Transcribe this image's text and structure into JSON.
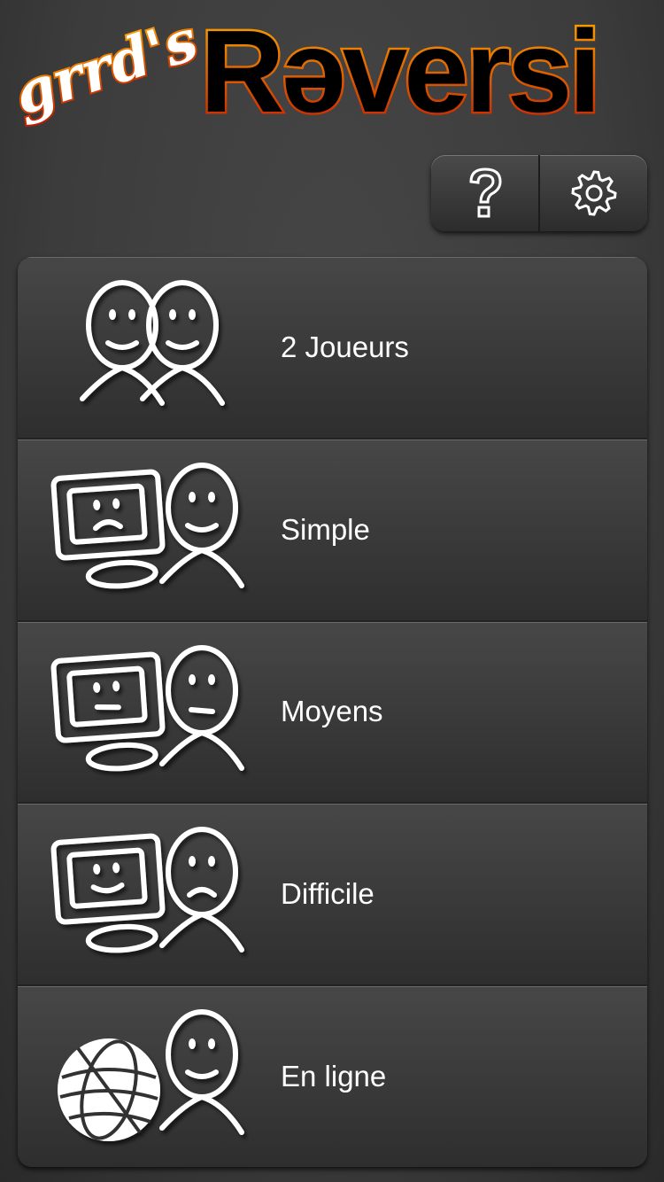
{
  "app": {
    "title_script": "grrd's",
    "title_main": "Rəversi",
    "logo_colors": {
      "outline_top": "#ffb000",
      "outline_bottom": "#c01800",
      "fill": "#000000"
    }
  },
  "toolbar": {
    "buttons": [
      {
        "name": "help",
        "icon": "question-icon"
      },
      {
        "name": "settings",
        "icon": "gear-icon"
      }
    ]
  },
  "menu": {
    "items": [
      {
        "label": "2 Joueurs",
        "icon": "two-players-icon",
        "left": "person-smile",
        "right": "person-smile"
      },
      {
        "label": "Simple",
        "icon": "computer-vs-player-easy-icon",
        "left": "computer-sad",
        "right": "person-smile"
      },
      {
        "label": "Moyens",
        "icon": "computer-vs-player-medium-icon",
        "left": "computer-neutral",
        "right": "person-neutral"
      },
      {
        "label": "Difficile",
        "icon": "computer-vs-player-hard-icon",
        "left": "computer-smile",
        "right": "person-sad"
      },
      {
        "label": "En ligne",
        "icon": "online-icon",
        "left": "globe",
        "right": "person-smile"
      }
    ]
  }
}
